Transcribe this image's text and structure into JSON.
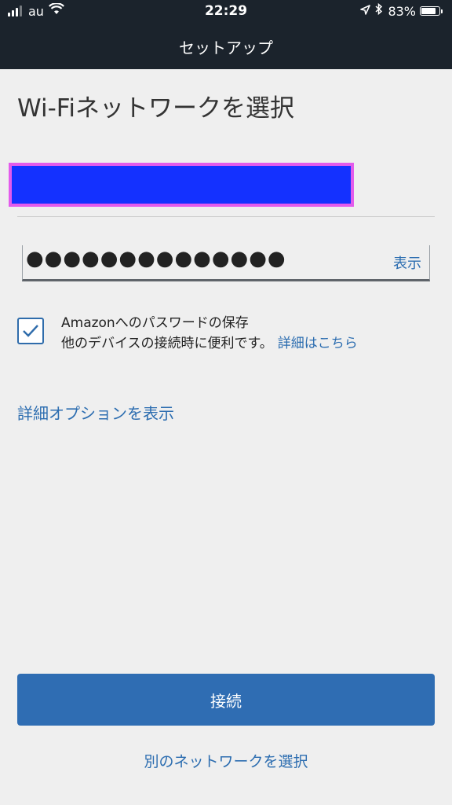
{
  "status_bar": {
    "carrier": "au",
    "time": "22:29",
    "battery_percent": "83%",
    "battery_level": 0.83
  },
  "nav": {
    "title": "セットアップ"
  },
  "page": {
    "title": "Wi-Fiネットワークを選択"
  },
  "network_field": {
    "value": ""
  },
  "password": {
    "value": "●●●●●●●●●●●●●●",
    "show_label": "表示"
  },
  "save_password": {
    "checked": true,
    "line1": "Amazonへのパスワードの保存",
    "line2": "他のデバイスの接続時に便利です。",
    "details_link": "詳細はこちら"
  },
  "advanced_options_link": "詳細オプションを表示",
  "connect_button_label": "接続",
  "other_network_link": "別のネットワークを選択",
  "colors": {
    "header_bg": "#1b232c",
    "accent": "#2f6db3",
    "link": "#2c6db0",
    "highlight_border": "#e35bec",
    "redaction_fill": "#1431ff"
  }
}
